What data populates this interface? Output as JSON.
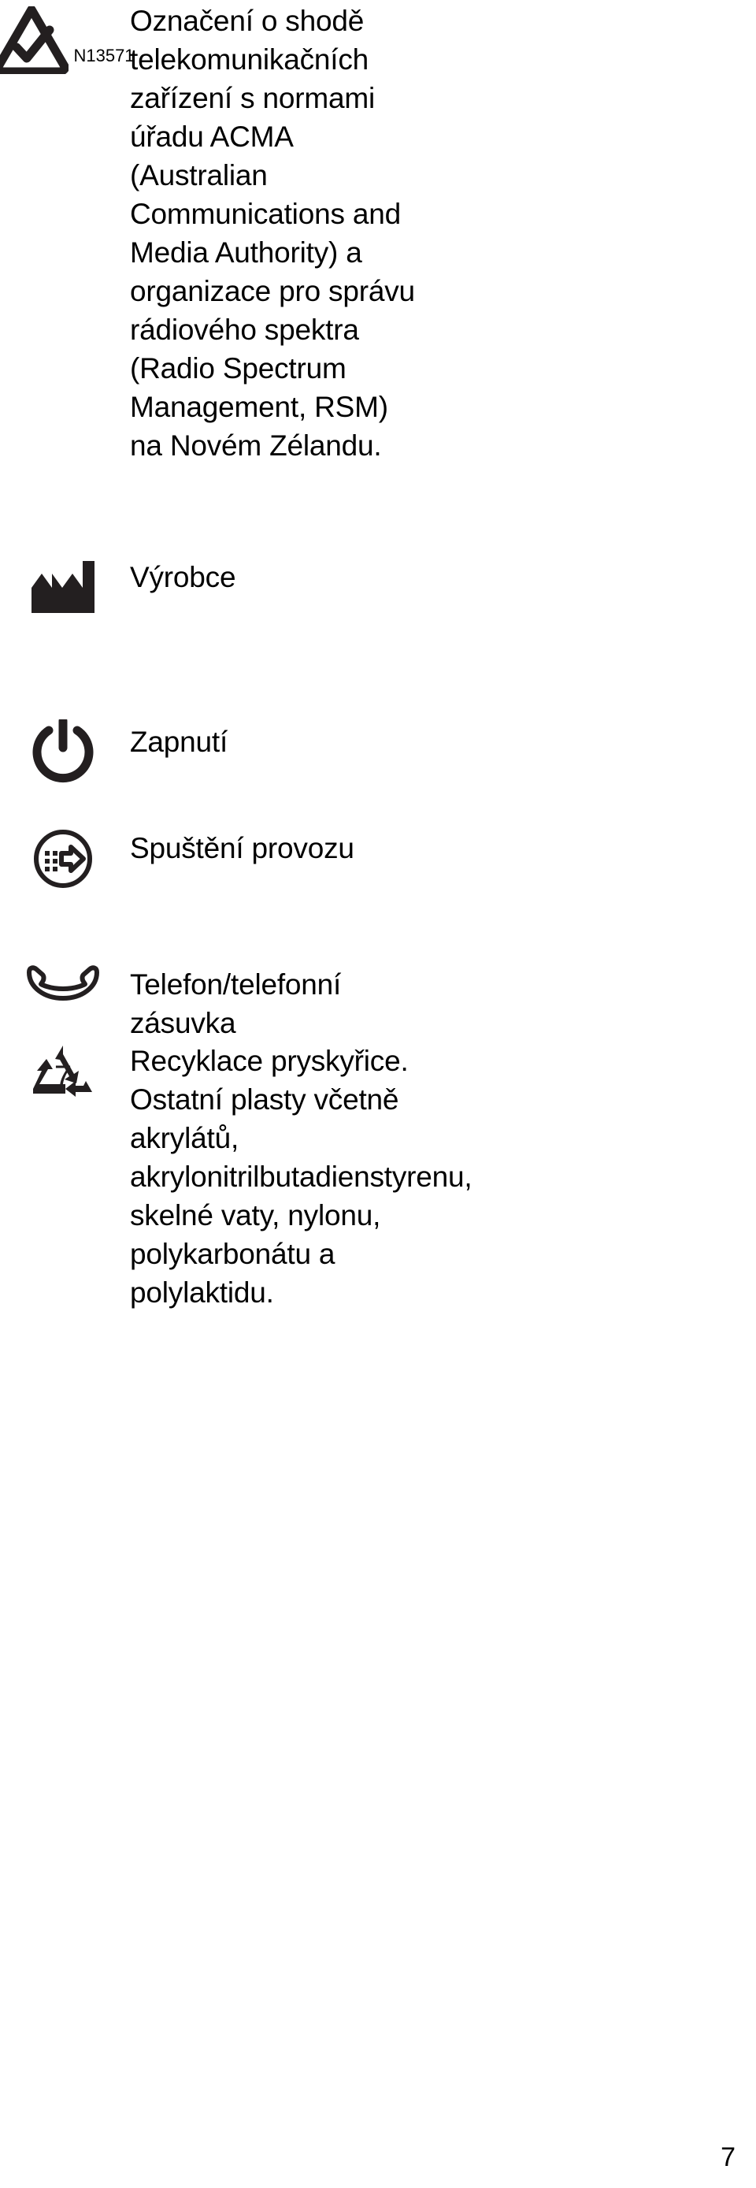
{
  "document": {
    "language": "cs",
    "page_number": "7",
    "text_color": "#000000",
    "background_color": "#ffffff"
  },
  "symbols": [
    {
      "icon": "acma-rcm-compliance-icon",
      "code": "N13571",
      "description": "Označení o shodě telekomunikačních zařízení s normami úřadu ACMA (Australian Communications and Media Authority) a organizace pro správu rádiového spektra (Radio Spectrum Management, RSM) na Novém Zélandu."
    },
    {
      "icon": "manufacturer-factory-icon",
      "code": "",
      "description": "Výrobce"
    },
    {
      "icon": "power-on-icon",
      "code": "",
      "description": "Zapnutí"
    },
    {
      "icon": "start-operation-icon",
      "code": "",
      "description": "Spuštění provozu"
    },
    {
      "icon": "telephone-handset-icon",
      "code": "",
      "description": "Telefon/telefonní zásuvka"
    },
    {
      "icon": "resin-recycling-code-7-icon",
      "code": "7",
      "description": "Recyklace pryskyřice. Ostatní plasty včetně akrylátů, akrylonitrilbutadienstyrenu, skelné vaty, nylonu, polykarbonátu a polylaktidu."
    }
  ]
}
